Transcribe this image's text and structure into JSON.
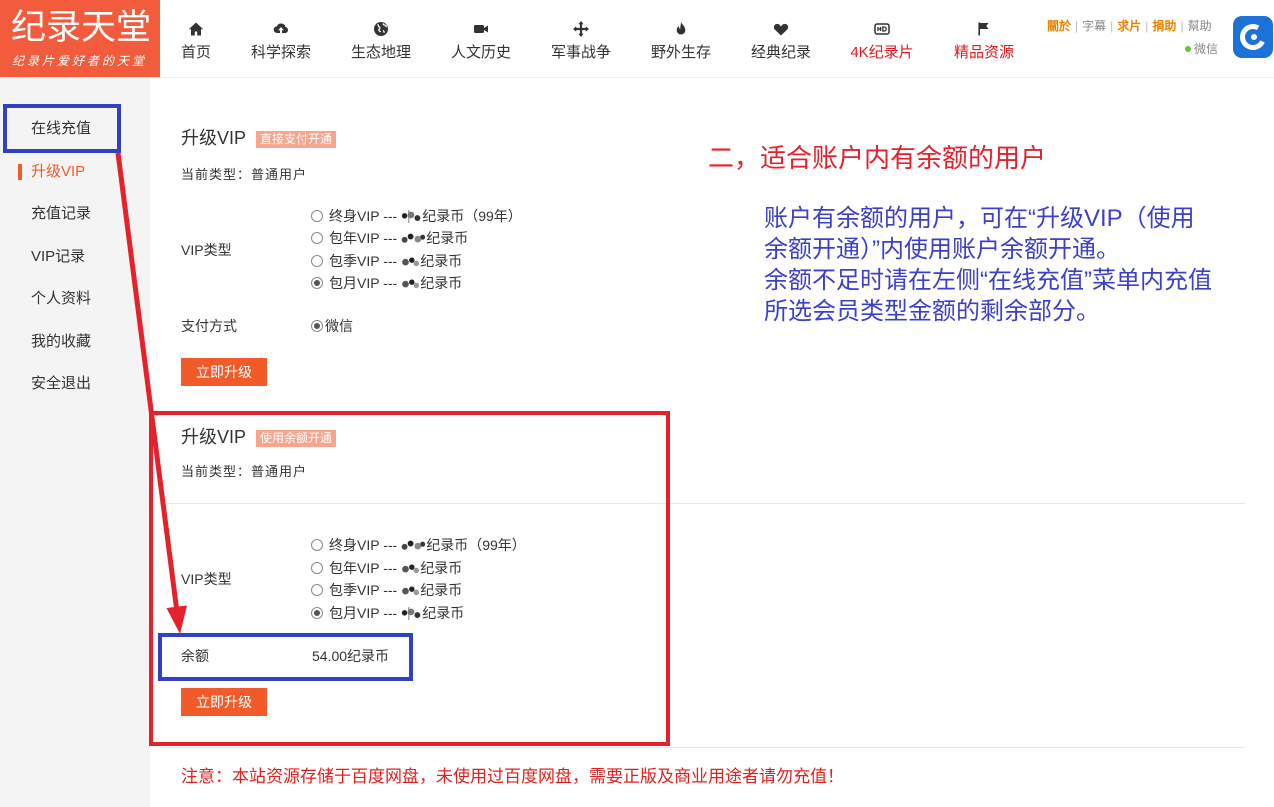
{
  "logo": {
    "title": "纪录天堂",
    "subtitle": "纪录片爱好者的天堂"
  },
  "nav": [
    {
      "label": "首页",
      "icon": "home-icon",
      "highlight": false
    },
    {
      "label": "科学探索",
      "icon": "cloud-upload-icon",
      "highlight": false
    },
    {
      "label": "生态地理",
      "icon": "globe-icon",
      "highlight": false
    },
    {
      "label": "人文历史",
      "icon": "video-camera-icon",
      "highlight": false
    },
    {
      "label": "军事战争",
      "icon": "move-arrows-icon",
      "highlight": false
    },
    {
      "label": "野外生存",
      "icon": "fire-icon",
      "highlight": false
    },
    {
      "label": "经典纪录",
      "icon": "heart-icon",
      "highlight": false
    },
    {
      "label": "4K纪录片",
      "icon": "hd-icon",
      "highlight": true
    },
    {
      "label": "精品资源",
      "icon": "flag-icon",
      "highlight": true
    }
  ],
  "top_links": {
    "separator": "|",
    "items": [
      {
        "label": "關於",
        "highlight": true
      },
      {
        "label": "字幕",
        "highlight": false
      },
      {
        "label": "求片",
        "highlight": true
      },
      {
        "label": "捐助",
        "highlight": true
      },
      {
        "label": "幫助",
        "highlight": false
      }
    ]
  },
  "wechat": {
    "label": "微信",
    "icon": "status-dot-icon"
  },
  "app_icon": "app-logo-icon",
  "sidebar": {
    "items": [
      {
        "label": "在线充值",
        "active": false
      },
      {
        "label": "升级VIP",
        "active": true
      },
      {
        "label": "充值记录",
        "active": false
      },
      {
        "label": "VIP记录",
        "active": false
      },
      {
        "label": "个人资料",
        "active": false
      },
      {
        "label": "我的收藏",
        "active": false
      },
      {
        "label": "安全退出",
        "active": false
      }
    ]
  },
  "forms": [
    {
      "title": "升级VIP",
      "badge": "直接支付开通",
      "current_type": "当前类型：普通用户",
      "vip_type_label": "VIP类型",
      "options": [
        {
          "prefix": "终身VIP ---",
          "suffix": "纪录币（99年）",
          "checked": false
        },
        {
          "prefix": "包年VIP ---",
          "suffix": "纪录币",
          "checked": false
        },
        {
          "prefix": "包季VIP ---",
          "suffix": "纪录币",
          "checked": false
        },
        {
          "prefix": "包月VIP ---",
          "suffix": "纪录币",
          "checked": true
        }
      ],
      "payment_label": "支付方式",
      "payment_option": {
        "label": "微信",
        "checked": true
      },
      "submit_label": "立即升级"
    },
    {
      "title": "升级VIP",
      "badge": "使用余额开通",
      "current_type": "当前类型：普通用户",
      "vip_type_label": "VIP类型",
      "options": [
        {
          "prefix": "终身VIP ---",
          "suffix": "纪录币（99年）",
          "checked": false
        },
        {
          "prefix": "包年VIP ---",
          "suffix": "纪录币",
          "checked": false
        },
        {
          "prefix": "包季VIP ---",
          "suffix": "纪录币",
          "checked": false
        },
        {
          "prefix": "包月VIP ---",
          "suffix": "纪录币",
          "checked": true
        }
      ],
      "balance_label": "余额",
      "balance_value": "54.00纪录币",
      "submit_label": "立即升级"
    }
  ],
  "notice": "注意：本站资源存储于百度网盘，未使用过百度网盘，需要正版及商业用途者请勿充值！",
  "annotation": {
    "heading": "二，适合账户内有余额的用户",
    "lines": [
      "账户有余额的用户，可在“升级VIP（使用",
      "余额开通）”内使用账户余额开通。",
      "余额不足时请在左侧“在线充值”菜单内充值",
      "所选会员类型金额的剩余部分。"
    ]
  },
  "colors": {
    "brand": "#f35b3d",
    "accent": "#f15a29",
    "nav_highlight": "#e3171c",
    "link_highlight": "#e98300",
    "link_normal": "#888888",
    "badge": "#f8a58e",
    "annotation_red": "#e4212c",
    "annotation_blue": "#3340c0",
    "annotation_text_blue": "#3b40c8",
    "notice": "#e0211d",
    "wechat_dot": "#67c23a",
    "app_icon": "#1c72d9"
  }
}
